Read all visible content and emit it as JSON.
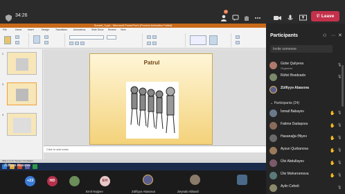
{
  "meeting": {
    "timer": "34:26",
    "leave_label": "Leave",
    "participants_badge": "25"
  },
  "powerpoint": {
    "window_title": "Sunset_3.ppt - Microsoft PowerPoint (Product Activation Failed)",
    "ribbon_tabs": [
      "File",
      "Home",
      "Insert",
      "Design",
      "Transitions",
      "Animations",
      "Slide Show",
      "Review",
      "View"
    ],
    "slide_numbers": [
      "2",
      "3",
      "4"
    ],
    "slide_title": "Patrul",
    "notes_placeholder": "Click to add notes",
    "share_toast": "www.teams.microsoft.com is sharing your screen.",
    "stop_sharing_label": "Stop sharing",
    "status_text": "Slide 3 of 12   \"Sunset\"   Azerbaijani"
  },
  "presenter_name": "Zülfiyyə Abasova",
  "strip": [
    {
      "initials": "+23",
      "name": "",
      "color": "#3a7bd5"
    },
    {
      "initials": "HD",
      "name": "",
      "color": "#b5304a"
    },
    {
      "initials": "",
      "name": "",
      "color": "#6b8e5a"
    },
    {
      "initials": "EH",
      "name": "Emil Hajiyev",
      "color": "#e9c7c7"
    },
    {
      "initials": "",
      "name": "Zülfiyyə Abasova",
      "color": "#5b5e8c"
    },
    {
      "initials": "",
      "name": "Zeynab Abbasli",
      "color": "#8a7a6a"
    },
    {
      "initials": "",
      "name": "",
      "color": "#4a6a8a"
    }
  ],
  "panel": {
    "title": "Participants",
    "search_placeholder": "Invite someone",
    "organizers": [
      {
        "name": "Gülər Quliyeva",
        "role": "Organizer"
      },
      {
        "name": "Rüfət Əsədzadə",
        "role": ""
      },
      {
        "name": "Zülfiyyə Abasova",
        "role": ""
      }
    ],
    "group_label": "Participants (24)",
    "attendees": [
      {
        "name": "İsmail Babayev",
        "hand": true
      },
      {
        "name": "Fatimə Dadaşova",
        "hand": true
      },
      {
        "name": "Hasanağa Əliyev",
        "hand": true
      },
      {
        "name": "Aysun Qurbanova",
        "hand": true
      },
      {
        "name": "Ülvi Abdullayev",
        "hand": true
      },
      {
        "name": "Ülvi Məhərrəmova",
        "hand": true
      },
      {
        "name": "Aylin Cəfərli",
        "hand": false
      }
    ]
  },
  "colors": {
    "teams_purple": "#6264a7",
    "leave_red": "#c4314b",
    "hand_yellow": "#e8b33a",
    "pp_orange": "#c86a1a"
  }
}
